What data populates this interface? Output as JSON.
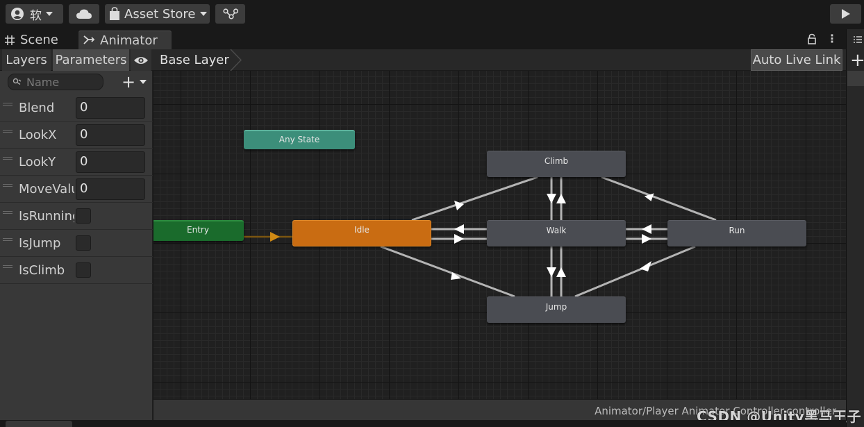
{
  "toolbar": {
    "account_label": "软",
    "asset_store_label": "Asset Store"
  },
  "tabs": {
    "scene": "Scene",
    "animator": "Animator"
  },
  "subbar": {
    "layers": "Layers",
    "parameters": "Parameters",
    "breadcrumb": "Base Layer",
    "auto_live_link": "Auto Live Link"
  },
  "params_panel": {
    "search_placeholder": "Name",
    "items": [
      {
        "name": "Blend",
        "type": "float",
        "value": "0"
      },
      {
        "name": "LookX",
        "type": "float",
        "value": "0"
      },
      {
        "name": "LookY",
        "type": "float",
        "value": "0"
      },
      {
        "name": "MoveValue",
        "type": "float",
        "value": "0"
      },
      {
        "name": "IsRunning",
        "type": "bool",
        "value": false
      },
      {
        "name": "IsJump",
        "type": "bool",
        "value": false
      },
      {
        "name": "IsClimb",
        "type": "bool",
        "value": false
      }
    ]
  },
  "graph": {
    "nodes": {
      "any_state": "Any State",
      "entry": "Entry",
      "idle": "Idle",
      "climb": "Climb",
      "walk": "Walk",
      "run": "Run",
      "jump": "Jump"
    },
    "colors": {
      "any_state": "#3c8e7a",
      "entry": "#1a6b2c",
      "default_state": "#c96c12",
      "state": "#4a4c52",
      "transition": "#b4b4b4",
      "default_transition": "#9a6a14"
    }
  },
  "status": {
    "path": "Animator/Player Animator Controller.controller"
  },
  "watermark": "CSDN @Unity黑马王子",
  "icons": [
    "account-icon",
    "cloud-icon",
    "bag-icon",
    "collab-icon",
    "play-icon",
    "grid-icon",
    "animator-icon",
    "lock-icon",
    "kebab-icon",
    "eye-icon",
    "search-icon",
    "plus-icon",
    "list-icon"
  ]
}
